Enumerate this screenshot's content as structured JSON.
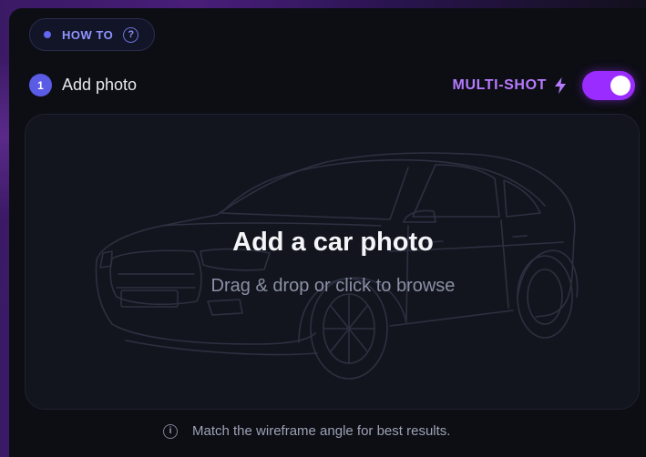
{
  "howto": {
    "label": "HOW TO",
    "dot_color": "#6366f1",
    "icon": "help-circle-icon"
  },
  "step": {
    "number": "1",
    "label": "Add photo"
  },
  "multishot": {
    "label": "MULTI-SHOT",
    "icon": "lightning-bolt-icon",
    "enabled": true,
    "accent_color": "#9b2cff"
  },
  "dropzone": {
    "title": "Add a car photo",
    "subtitle": "Drag & drop or click to browse",
    "background_icon": "car-wireframe"
  },
  "hint": {
    "icon": "info-icon",
    "text": "Match the wireframe angle for best results."
  }
}
